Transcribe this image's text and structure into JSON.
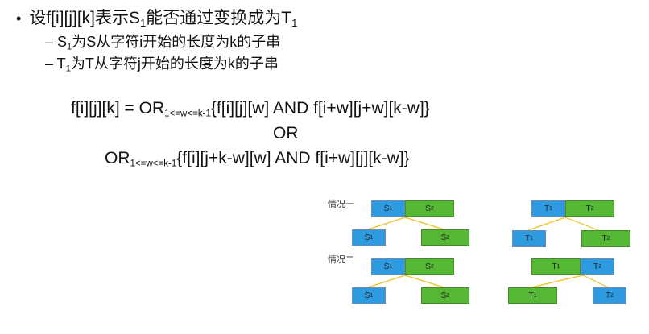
{
  "text": {
    "bullet": "•",
    "line1_a": "设f[i][j][k]表示S",
    "line1_sub": "1",
    "line1_b": "能否通过变换成为T",
    "line1_sub2": "1",
    "sub2_dash": "– S",
    "sub2_sub": "1",
    "sub2_rest": "为S从字符i开始的长度为k的子串",
    "sub3_dash": "– T",
    "sub3_sub": "1",
    "sub3_rest": "为T从字符j开始的长度为k的子串"
  },
  "formula": {
    "f1_a": "f[i][j][k] = OR",
    "f1_sub": "1<=w<=k-1",
    "f1_b": "{f[i][j][w] AND f[i+w][j+w][k-w]}",
    "or": "OR",
    "f3_a": "OR",
    "f3_sub": "1<=w<=k-1",
    "f3_b": "{f[i][j+k-w][w] AND f[i+w][j][k-w]}"
  },
  "diagram": {
    "case1": "情况一",
    "case2": "情况二",
    "S": "S",
    "T": "T",
    "one": "1",
    "two": "2"
  },
  "colors": {
    "blue": "#2e9be0",
    "green": "#55b835",
    "connector": "#f0c020"
  }
}
